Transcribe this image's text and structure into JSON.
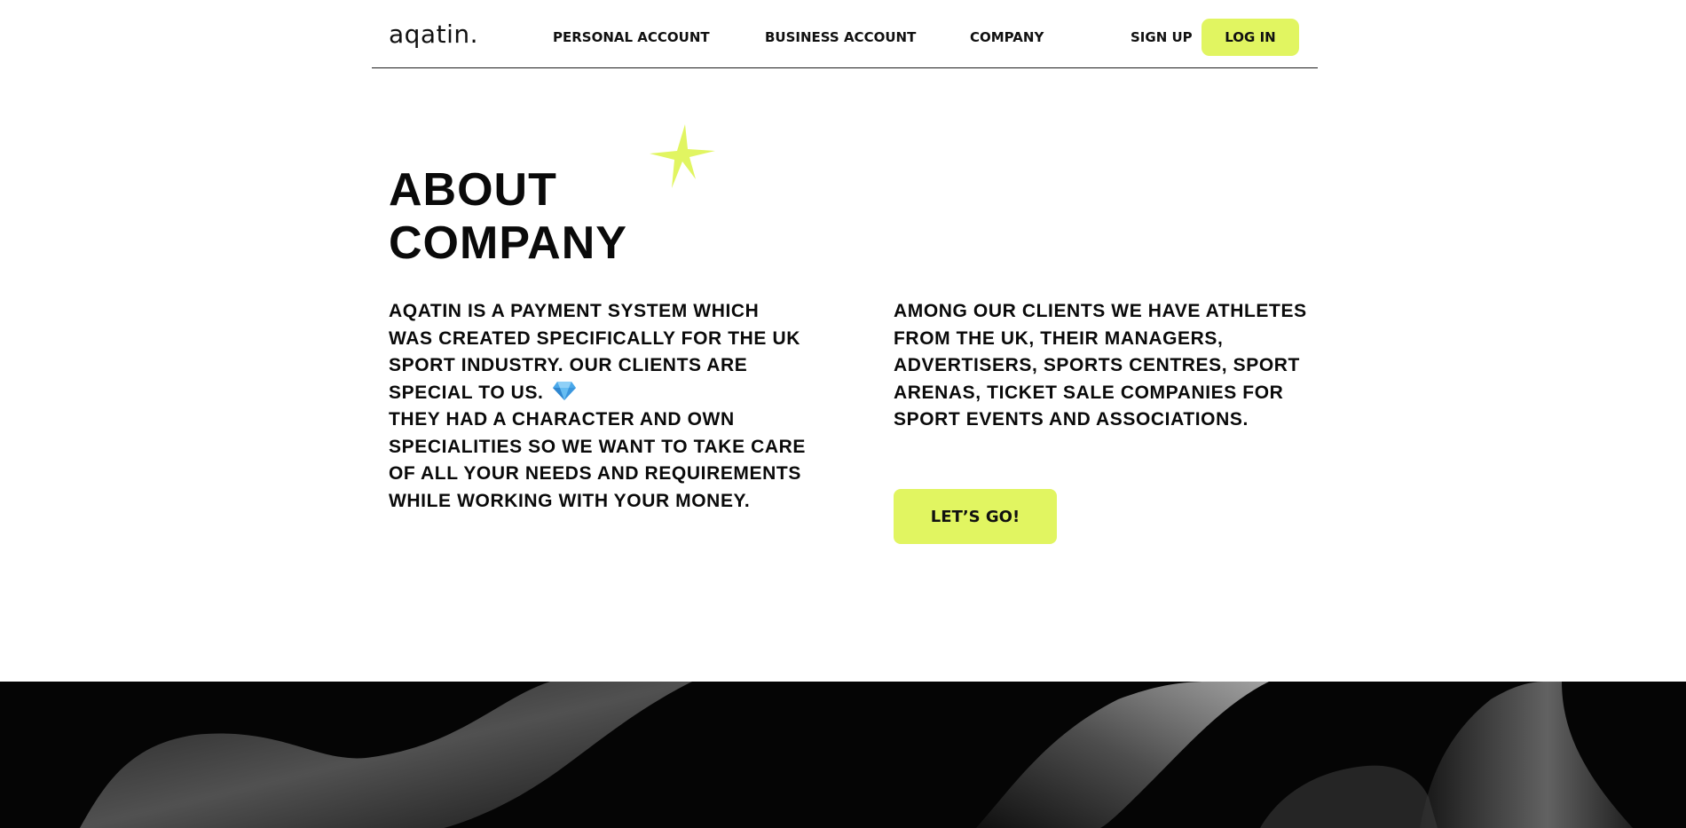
{
  "header": {
    "logo": "aqatin.",
    "nav": {
      "personal": "PERSONAL ACCOUNT",
      "business": "BUSINESS ACCOUNT",
      "company": "COMPANY"
    },
    "sign_up": "SIGN UP",
    "log_in": "LOG IN"
  },
  "hero": {
    "title_line1": "ABOUT",
    "title_line2": "COMPANY",
    "left_text_part1": "AQATIN IS A PAYMENT SYSTEM WHICH WAS CREATED SPECIFICALLY FOR THE UK SPORT INDUSTRY. OUR CLIENTS ARE SPECIAL TO US.",
    "left_text_part2": "THEY HAD A CHARACTER AND OWN SPECIALITIES SO WE WANT TO TAKE CARE OF ALL YOUR NEEDS AND REQUIREMENTS WHILE WORKING WITH YOUR MONEY.",
    "right_text": "AMONG OUR CLIENTS WE HAVE ATHLETES FROM THE UK, THEIR MANAGERS, ADVERTISERS, SPORTS CENTRES, SPORT ARENAS, TICKET SALE COMPANIES FOR SPORT EVENTS AND ASSOCIATIONS.",
    "cta": "LET’S GO!"
  },
  "icons": {
    "star": "star-burst-icon",
    "gem": "gem-icon"
  },
  "colors": {
    "accent": "#e1f561",
    "text": "#0a0a0a",
    "band": "#050505",
    "gem": "#4aa8ea"
  }
}
